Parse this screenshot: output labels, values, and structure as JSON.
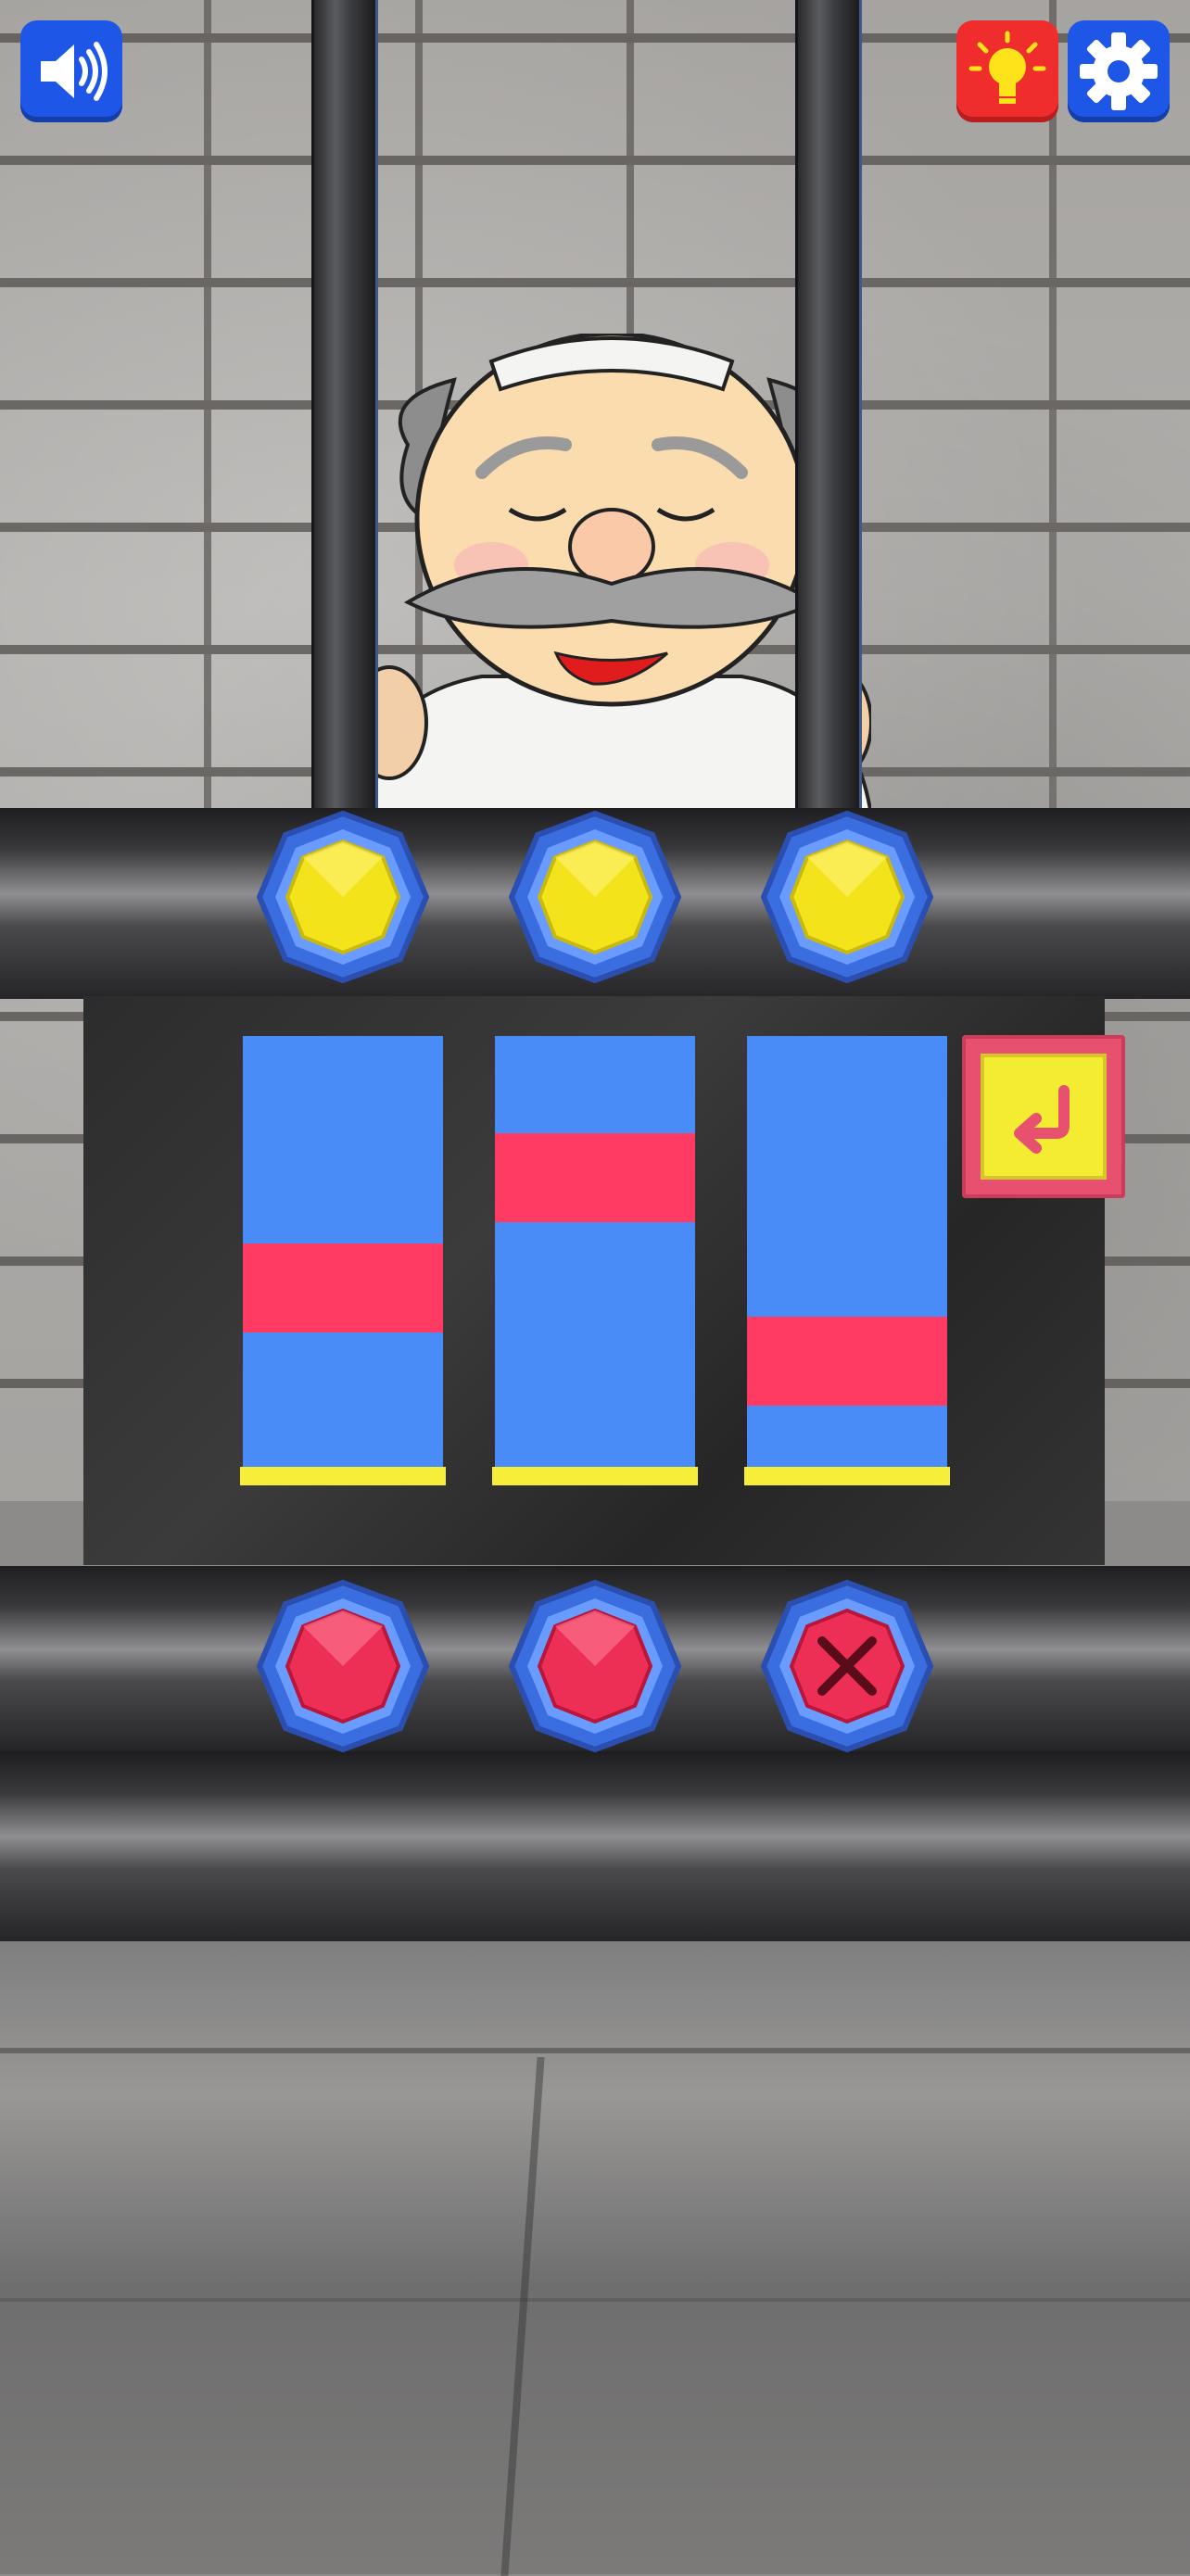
{
  "hud": {
    "sound_icon": "speaker-volume-icon",
    "hint_icon": "lightbulb-icon",
    "settings_icon": "gear-icon",
    "colors": {
      "sound_bg": "#1e57e8",
      "hint_bg": "#ef2d2d",
      "settings_bg": "#1e57e8"
    }
  },
  "puzzle": {
    "columns": [
      {
        "id": "column-1",
        "marker_level": 0.4
      },
      {
        "id": "column-2",
        "marker_level": 0.72
      },
      {
        "id": "column-3",
        "marker_level": 0.19
      }
    ],
    "top_buttons": [
      {
        "id": "yellow-gem-1",
        "color": "#f2e31b",
        "icon": "gem-icon"
      },
      {
        "id": "yellow-gem-2",
        "color": "#f2e31b",
        "icon": "gem-icon"
      },
      {
        "id": "yellow-gem-3",
        "color": "#f2e31b",
        "icon": "gem-icon"
      }
    ],
    "bottom_buttons": [
      {
        "id": "red-gem-1",
        "color": "#ee2f55",
        "icon": "gem-icon"
      },
      {
        "id": "red-gem-2",
        "color": "#ee2f55",
        "icon": "gem-icon"
      },
      {
        "id": "red-gem-cancel",
        "color": "#ee2f55",
        "icon": "close-x-icon"
      }
    ],
    "reset_icon": "return-arrow-icon",
    "colors": {
      "column": "#4a8cf7",
      "marker": "#ff3b63",
      "column_base": "#f7ee3a",
      "reset_bg": "#f4ec31",
      "reset_border": "#e8506f"
    }
  }
}
